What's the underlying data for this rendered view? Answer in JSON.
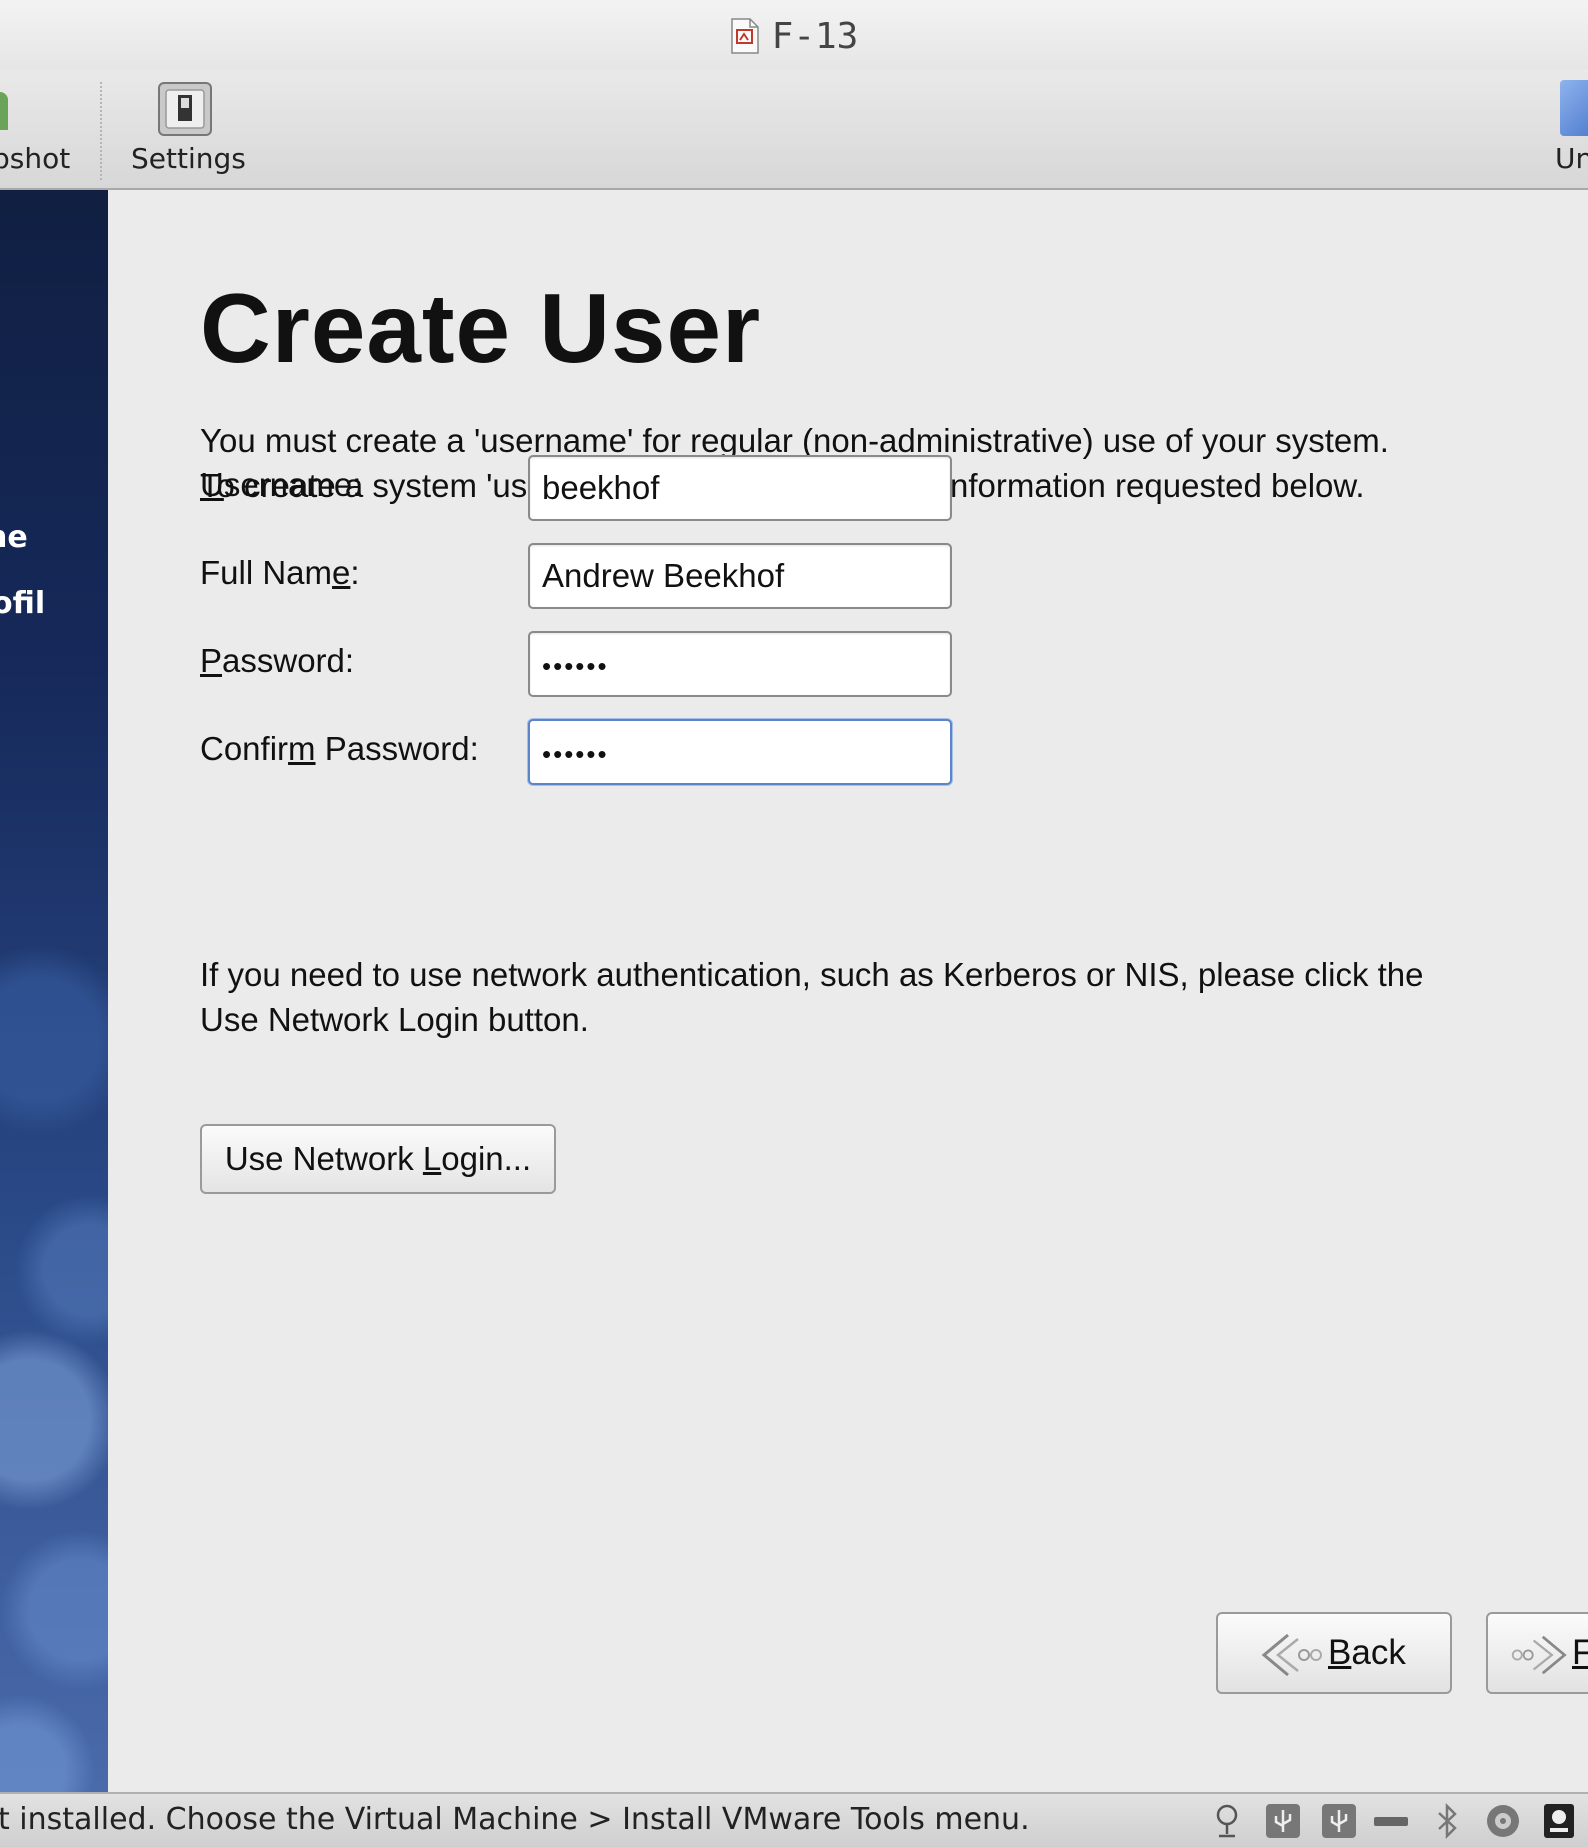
{
  "window": {
    "title": "F-13"
  },
  "toolbar": {
    "snapshot_label": "pshot",
    "settings_label": "Settings",
    "unity_label": "Un"
  },
  "sidebar": {
    "items": [
      {
        "label": "ne"
      },
      {
        "label": "ofil"
      }
    ]
  },
  "page": {
    "title": "Create User",
    "intro_line1": "You must create a 'username' for regular (non-administrative) use of your system.",
    "intro_line2": "To create a system 'username', please provide the information requested below."
  },
  "form": {
    "username": {
      "label_mnemonic": "U",
      "label_rest": "sername:",
      "value": "beekhof"
    },
    "full_name": {
      "label_pre": "Full Nam",
      "label_mnemonic": "e",
      "label_post": ":",
      "value": "Andrew Beekhof"
    },
    "password": {
      "label_mnemonic": "P",
      "label_rest": "assword:",
      "value": "••••••"
    },
    "confirm_password": {
      "label_pre": "Confir",
      "label_mnemonic": "m",
      "label_post": " Password:",
      "value": "••••••"
    }
  },
  "network": {
    "text_line1": "If you need to use network authentication, such as Kerberos or NIS, please click the",
    "text_line2": "Use Network Login button.",
    "button_pre": "Use Network ",
    "button_mnemonic": "L",
    "button_post": "ogin..."
  },
  "nav": {
    "back_mnemonic": "B",
    "back_rest": "ack",
    "forward_mnemonic": "F"
  },
  "statusbar": {
    "message": "t installed. Choose the Virtual Machine > Install VMware Tools menu.",
    "icons": [
      "network-icon",
      "usb-icon",
      "usb-icon",
      "cd-drive-icon",
      "bluetooth-icon",
      "sound-icon",
      "hard-disk-icon"
    ]
  },
  "colors": {
    "sidebar_dark": "#101f42",
    "sidebar_light": "#4a6aaa",
    "focus_border": "#5b85c8",
    "background": "#ebebeb"
  }
}
